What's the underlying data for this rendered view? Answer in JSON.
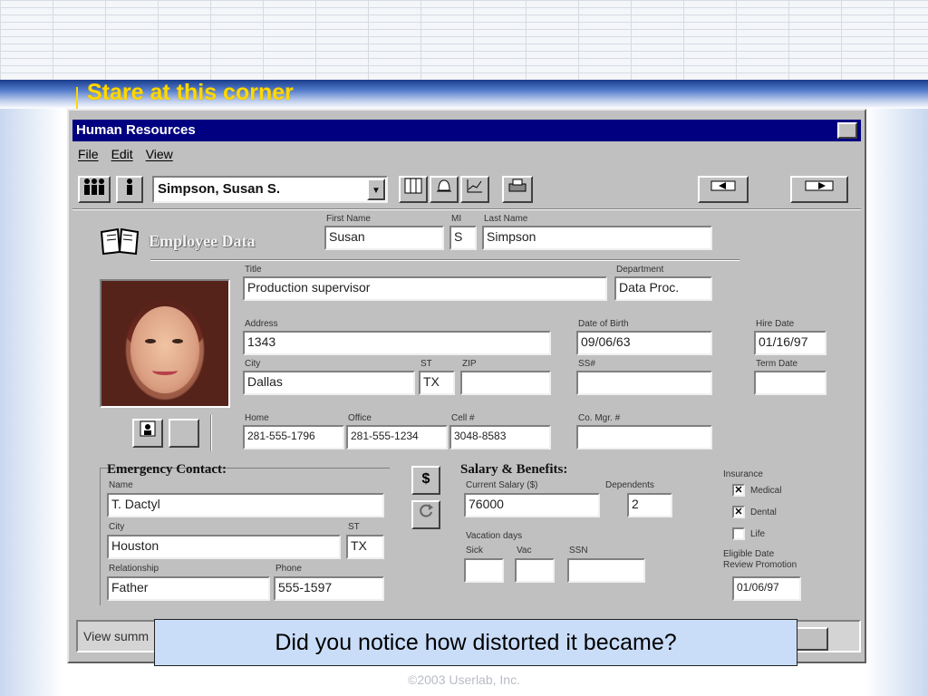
{
  "slide": {
    "headline": "Stare at this corner",
    "caption": "Did you notice how distorted it became?",
    "copyright": "©2003 Userlab, Inc.",
    "headline_color": "#ffd800",
    "band_color": "#1a3c8c"
  },
  "window": {
    "title": "Human Resources",
    "title_color": "#000080",
    "menu": [
      "File",
      "Edit",
      "View"
    ]
  },
  "toolbar": {
    "employee_combo": "Simpson, Susan S.",
    "icons": [
      "group-icon",
      "person-icon",
      "dropdown-arrow-icon",
      "grid-icon",
      "bell-icon",
      "chart-icon",
      "printer-icon",
      "prev-record-icon",
      "next-record-icon"
    ]
  },
  "employee": {
    "section_title": "Employee Data",
    "first_name_label": "First Name",
    "first_name": "Susan",
    "mi_label": "MI",
    "mi": "S",
    "last_name_label": "Last Name",
    "last_name": "Simpson",
    "title_label": "Title",
    "title": "Production supervisor",
    "department_label": "Department",
    "department": "Data Proc.",
    "address_label": "Address",
    "address": "1343",
    "dob_label": "Date of Birth",
    "dob": "09/06/63",
    "hire_date_label": "Hire Date",
    "hire_date": "01/16/97",
    "city_label": "City",
    "city": "Dallas",
    "st_label": "ST",
    "st": "TX",
    "zip_label": "ZIP",
    "zip": "",
    "ssn_label": "SS#",
    "ssn": "",
    "term_date_label": "Term Date",
    "term_date": "",
    "home_label": "Home",
    "home": "281-555-1796",
    "office_label": "Office",
    "office": "281-555-1234",
    "cell_label": "Cell #",
    "cell": "3048-8583",
    "co_mgr_label": "Co. Mgr. #",
    "co_mgr": ""
  },
  "emergency": {
    "title": "Emergency Contact:",
    "name_label": "Name",
    "name": "T. Dactyl",
    "city_label": "City",
    "city": "Houston",
    "st_label": "ST",
    "st": "TX",
    "relationship_label": "Relationship",
    "relationship": "Father",
    "phone_label": "Phone",
    "phone": "555-1597"
  },
  "salary": {
    "title": "Salary & Benefits:",
    "current_salary_label": "Current Salary ($)",
    "current_salary": "76000",
    "dependents_label": "Dependents",
    "dependents": "2",
    "vacation_label": "Vacation days",
    "sick_label": "Sick",
    "sick": "",
    "vac_label": "Vac",
    "vac": "",
    "ssn_label": "SSN",
    "ssn": ""
  },
  "insurance": {
    "title": "Insurance",
    "options": [
      {
        "label": "Medical",
        "checked": true
      },
      {
        "label": "Dental",
        "checked": true
      },
      {
        "label": "Life",
        "checked": false
      }
    ],
    "eligible_label": "Eligible Date",
    "review_label": "Review Promotion",
    "date": "01/06/97"
  },
  "status": {
    "text": "View summ"
  }
}
